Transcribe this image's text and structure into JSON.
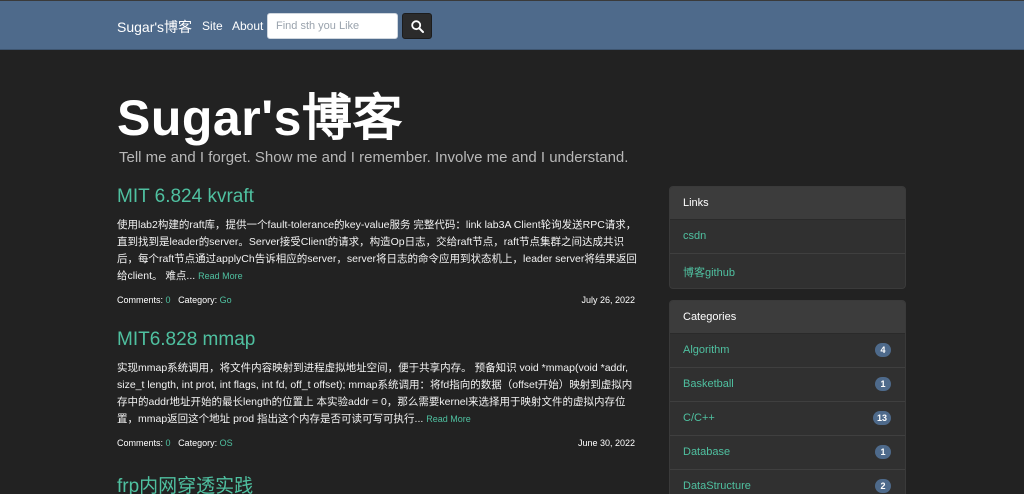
{
  "navbar": {
    "brand": "Sugar's博客",
    "links": [
      "Site",
      "About"
    ],
    "search_placeholder": "Find sth you Like",
    "search_icon": "search-icon"
  },
  "hero": {
    "title": "Sugar's博客",
    "subtitle": "Tell me and I forget. Show me and I remember. Involve me and I understand."
  },
  "posts": [
    {
      "title": "MIT 6.824 kvraft",
      "excerpt": "使用lab2构建的raft库，提供一个fault-tolerance的key-value服务 完整代码：link lab3A Client轮询发送RPC请求，直到找到是leader的server。Server接受Client的请求，构造Op日志，交给raft节点，raft节点集群之间达成共识后，每个raft节点通过applyCh告诉相应的server，server将日志的命令应用到状态机上，leader server将结果返回给client。 难点...",
      "read_more": "Read More",
      "comments_label": "Comments:",
      "comments": "0",
      "category_label": "Category:",
      "category": "Go",
      "date": "July 26, 2022"
    },
    {
      "title": "MIT6.828 mmap",
      "excerpt": "实现mmap系统调用，将文件内容映射到进程虚拟地址空间，便于共享内存。 预备知识 void *mmap(void *addr, size_t length, int prot, int flags, int fd, off_t offset); mmap系统调用：将fd指向的数据（offset开始）映射到虚拟内存中的addr地址开始的最长length的位置上 本实验addr = 0，那么需要kernel来选择用于映射文件的虚拟内存位置，mmap返回这个地址 prod 指出这个内存是否可读可写可执行...",
      "read_more": "Read More",
      "comments_label": "Comments:",
      "comments": "0",
      "category_label": "Category:",
      "category": "OS",
      "date": "June 30, 2022"
    },
    {
      "title": "frp内网穿透实践"
    }
  ],
  "sidebar": {
    "links_heading": "Links",
    "links": [
      "csdn",
      "博客github"
    ],
    "categories_heading": "Categories",
    "categories": [
      {
        "name": "Algorithm",
        "count": "4"
      },
      {
        "name": "Basketball",
        "count": "1"
      },
      {
        "name": "C/C++",
        "count": "13"
      },
      {
        "name": "Database",
        "count": "1"
      },
      {
        "name": "DataStructure",
        "count": "2"
      }
    ]
  },
  "colors": {
    "navbar": "#4e6a8b",
    "background": "#222222",
    "accent": "#4fc0a0"
  }
}
